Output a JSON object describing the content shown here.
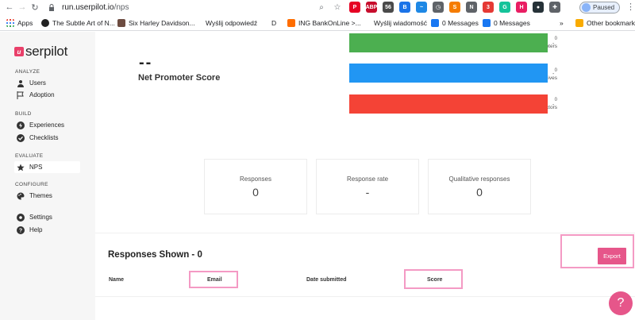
{
  "browser": {
    "url_domain": "run.userpilot.io",
    "url_path": "/nps",
    "paused_label": "Paused",
    "extensions": [
      {
        "icon": "pinterest-icon",
        "color": "#e60023",
        "text": "P"
      },
      {
        "icon": "abp-icon",
        "color": "#c70d2c",
        "text": "ABP"
      },
      {
        "icon": "user-badge-icon",
        "color": "#4a4a4a",
        "text": "56"
      },
      {
        "icon": "b-icon",
        "color": "#1a73e8",
        "text": "B"
      },
      {
        "icon": "wave-icon",
        "color": "#1e88e5",
        "text": "~"
      },
      {
        "icon": "clock-icon",
        "color": "#5f6368",
        "text": "◷"
      },
      {
        "icon": "s-icon",
        "color": "#f57c00",
        "text": "S"
      },
      {
        "icon": "n-icon",
        "color": "#5f6368",
        "text": "N"
      },
      {
        "icon": "mail-badge-icon",
        "color": "#e53935",
        "text": "3"
      },
      {
        "icon": "grammarly-icon",
        "color": "#15c39a",
        "text": "G"
      },
      {
        "icon": "h-icon",
        "color": "#e91e63",
        "text": "H"
      },
      {
        "icon": "circle-icon",
        "color": "#263238",
        "text": "●"
      },
      {
        "icon": "puzzle-icon",
        "color": "#5f6368",
        "text": "✚"
      }
    ]
  },
  "bookmarks": {
    "apps": "Apps",
    "items": [
      "The Subtle Art of N...",
      "Six Harley Davidson...",
      "Wyślij odpowiedź",
      "D",
      "ING BankOnLine >...",
      "Wyślij wiadomość",
      "0 Messages",
      "0 Messages"
    ],
    "more": "»",
    "other": "Other bookmarks"
  },
  "sidebar": {
    "logo_text": "serpilot",
    "logo_mark": "u",
    "sections": [
      {
        "title": "ANALYZE",
        "items": [
          {
            "label": "Users",
            "icon": "users-icon"
          },
          {
            "label": "Adoption",
            "icon": "flag-icon"
          }
        ]
      },
      {
        "title": "BUILD",
        "items": [
          {
            "label": "Experiences",
            "icon": "lightning-icon"
          },
          {
            "label": "Checklists",
            "icon": "checklist-icon"
          }
        ]
      },
      {
        "title": "EVALUATE",
        "items": [
          {
            "label": "NPS",
            "icon": "star-icon"
          }
        ]
      },
      {
        "title": "CONFIGURE",
        "items": [
          {
            "label": "Themes",
            "icon": "palette-icon"
          }
        ]
      },
      {
        "title": "",
        "items": [
          {
            "label": "Settings",
            "icon": "settings-icon"
          },
          {
            "label": "Help",
            "icon": "help-icon"
          }
        ]
      }
    ]
  },
  "nps": {
    "score": "--",
    "label": "Net Promoter Score",
    "bars": [
      {
        "count": "0",
        "name": "Promoters",
        "color": "#4caf50",
        "dash": "-"
      },
      {
        "count": "0",
        "name": "Passives",
        "color": "#2196f3",
        "dash": "-"
      },
      {
        "count": "0",
        "name": "Detractors",
        "color": "#f44336",
        "dash": "-"
      }
    ]
  },
  "stats": [
    {
      "label": "Responses",
      "value": "0"
    },
    {
      "label": "Response rate",
      "value": "-"
    },
    {
      "label": "Qualitative responses",
      "value": "0"
    }
  ],
  "responses": {
    "title": "Responses Shown - 0",
    "export_label": "Export",
    "columns": [
      "Name",
      "Email",
      "Date submitted",
      "Score"
    ]
  },
  "help_fab": "?"
}
